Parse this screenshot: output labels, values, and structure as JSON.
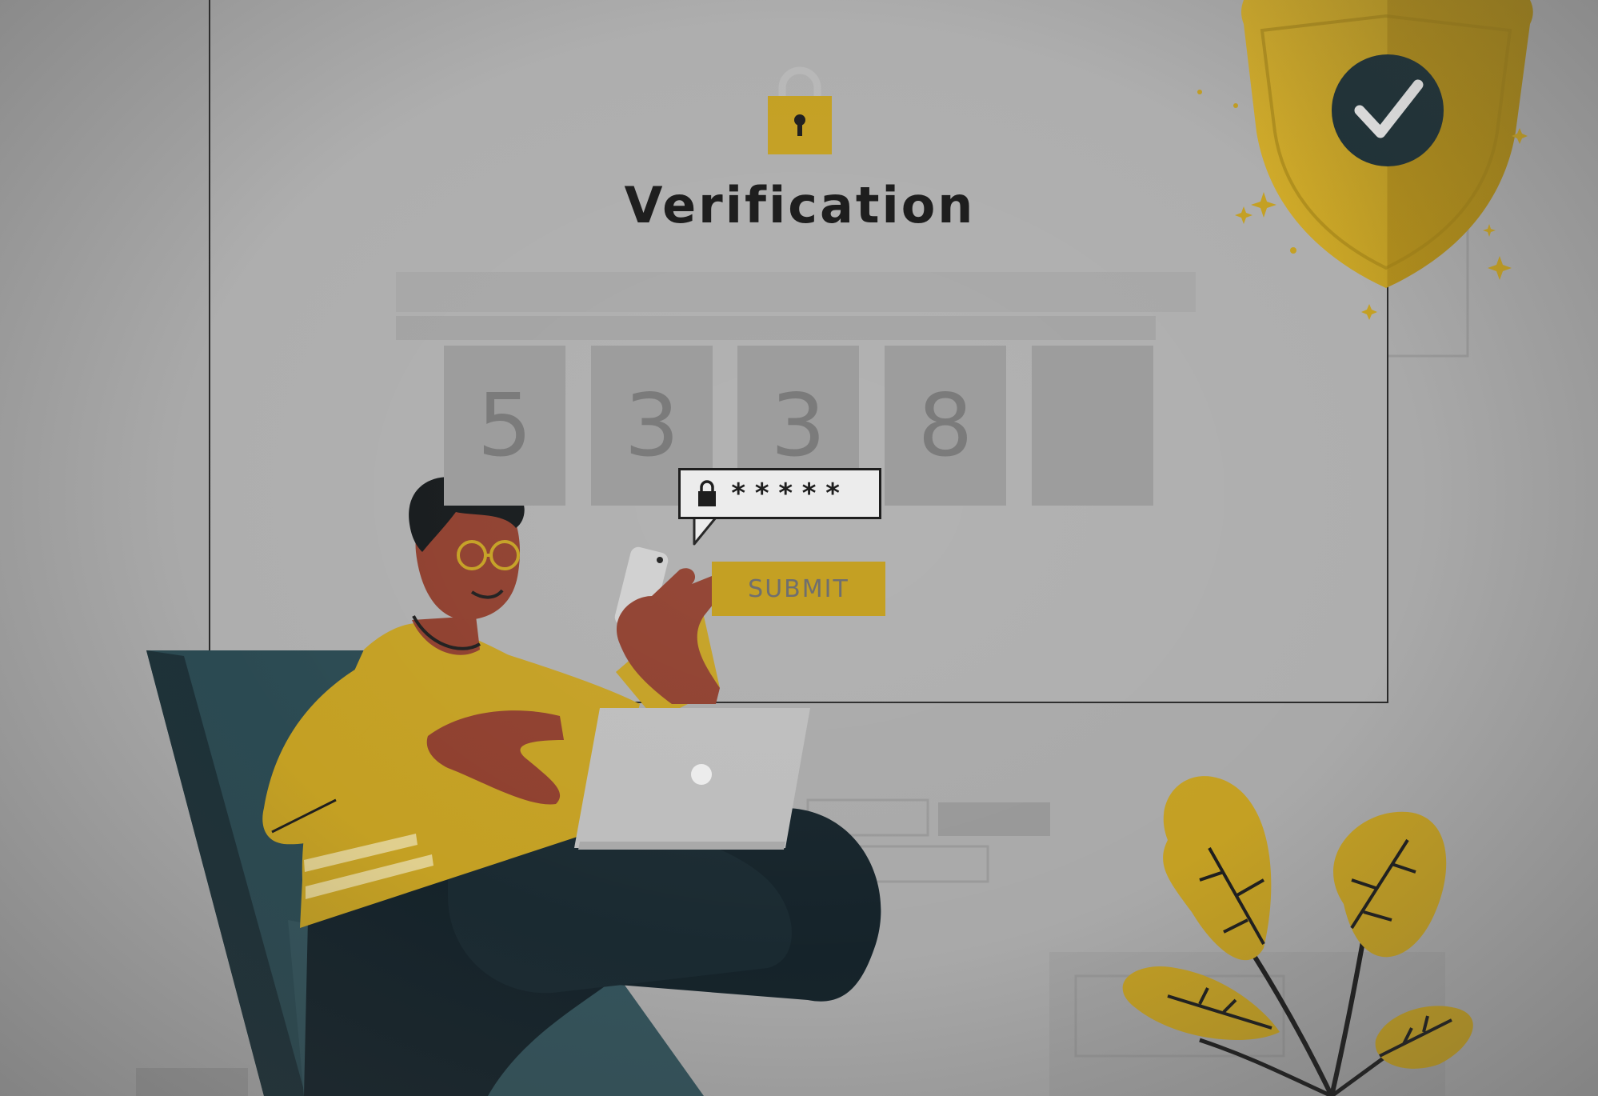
{
  "verification": {
    "title": "Verification",
    "code_digits": [
      "5",
      "3",
      "3",
      "8",
      ""
    ],
    "password_mask": "*****",
    "submit_label": "SUBMIT"
  },
  "colors": {
    "background": "#a9a9a9",
    "accent_yellow": "#c4a023",
    "dark_teal": "#2b4a52",
    "skin": "#8f3f2e",
    "text_dark": "#1e1e1e"
  },
  "icons": {
    "header": "padlock-icon",
    "password": "padlock-icon",
    "badge": "shield-check-icon"
  }
}
